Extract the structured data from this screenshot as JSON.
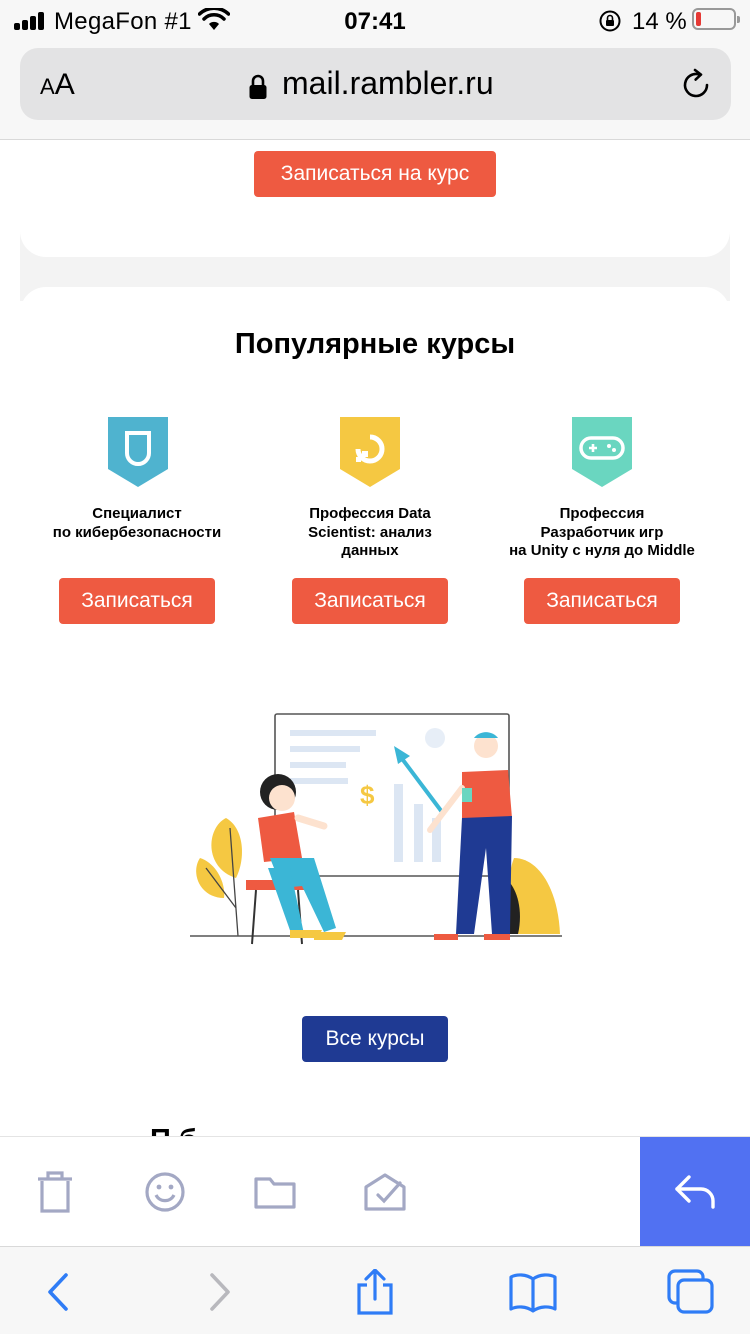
{
  "status_bar": {
    "carrier": "MegaFon #1",
    "time": "07:41",
    "battery_percent": "14 %",
    "battery_level": 0.14
  },
  "browser": {
    "text_size_label_small": "A",
    "text_size_label_large": "A",
    "url": "mail.rambler.ru"
  },
  "page": {
    "signup_course_button": "Записаться на курс",
    "section_title": "Популярные курсы",
    "courses": [
      {
        "name_line1": "Специалист",
        "name_line2": "по кибербезопасности",
        "name_line3": "",
        "button": "Записаться",
        "icon_color": "#4fb3cf"
      },
      {
        "name_line1": "Профессия Data",
        "name_line2": "Scientist: анализ",
        "name_line3": "данных",
        "button": "Записаться",
        "icon_color": "#f5c842"
      },
      {
        "name_line1": "Профессия",
        "name_line2": "Разработчик игр",
        "name_line3": "на Unity с нуля до Middle",
        "button": "Записаться",
        "icon_color": "#6ad6c0"
      }
    ],
    "all_courses_button": "Все курсы",
    "next_heading_partial": "П                        б"
  },
  "colors": {
    "accent_red": "#ee5a41",
    "accent_blue": "#1f3a93",
    "reply_blue": "#5171f2",
    "toolbar_icon": "#a3a8c4",
    "safari_blue": "#2f7cf6"
  }
}
